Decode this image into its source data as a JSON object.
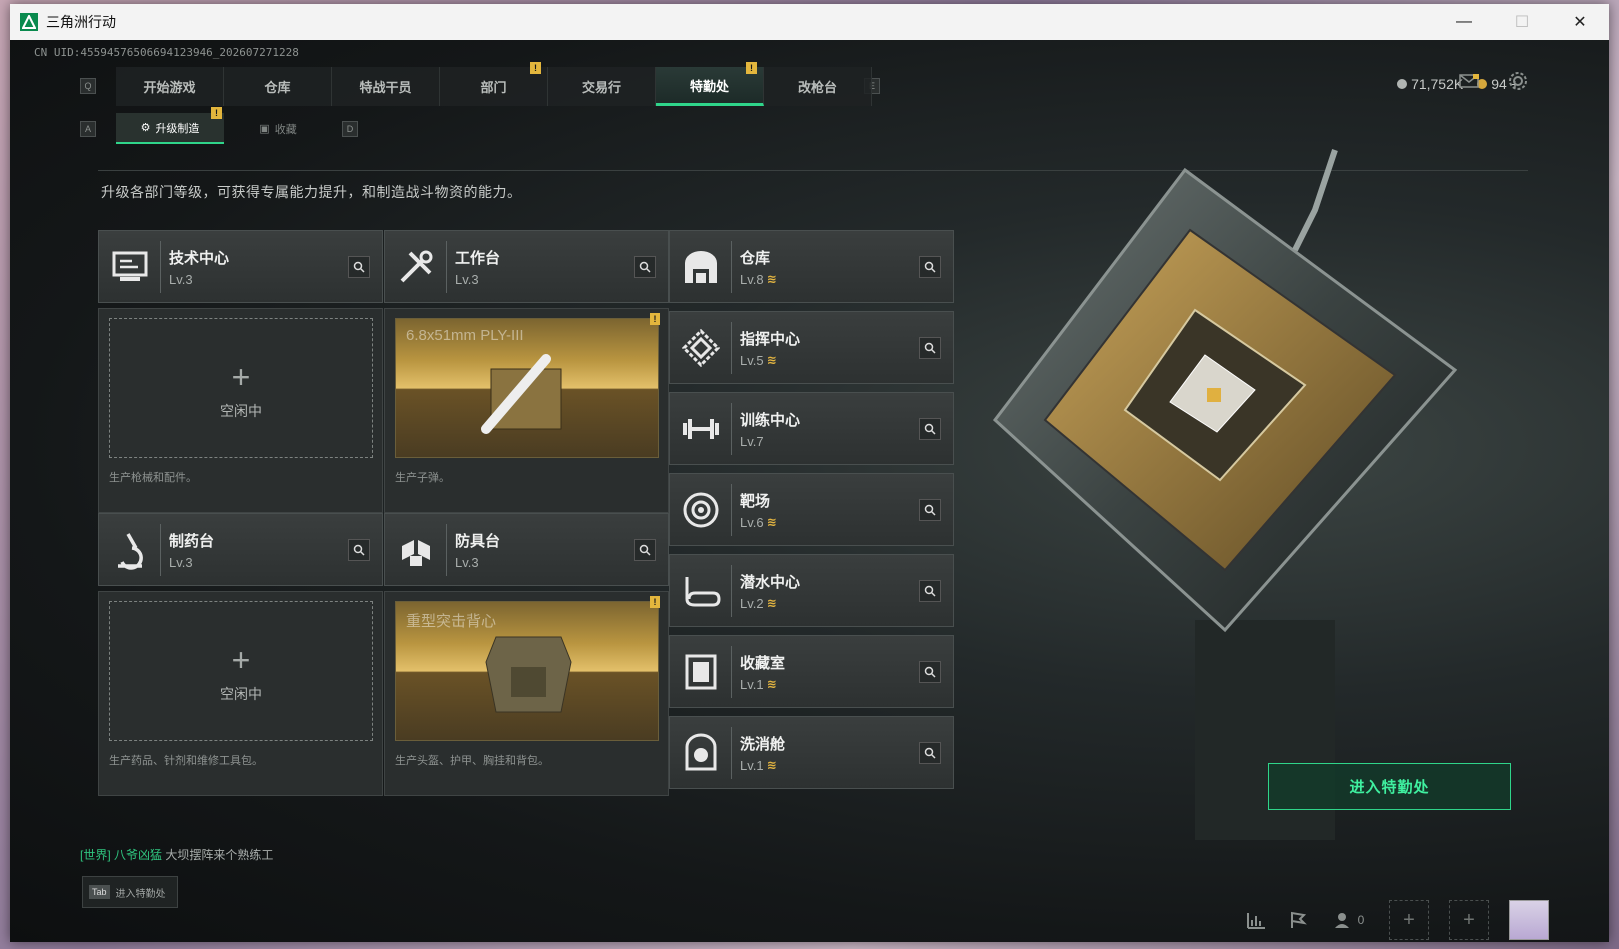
{
  "window": {
    "title": "三角洲行动",
    "minimize": "—",
    "maximize": "☐",
    "close": "✕"
  },
  "uid": "CN UID:4559457650669412394​6_202607271228",
  "tabs": [
    {
      "label": "开始游戏"
    },
    {
      "label": "仓库"
    },
    {
      "label": "特战干员"
    },
    {
      "label": "部门",
      "badge": "!"
    },
    {
      "label": "交易行"
    },
    {
      "label": "特勤处",
      "badge": "!",
      "active": true
    },
    {
      "label": "改枪台"
    }
  ],
  "keyhints": {
    "left": "Q",
    "right": "E",
    "sub_left": "A",
    "sub_right": "D"
  },
  "currency": {
    "silver": "71,752K",
    "gold": "94",
    "plus": "+"
  },
  "subtabs": [
    {
      "label": "升级制造",
      "badge": "!",
      "active": true
    },
    {
      "label": "收藏"
    }
  ],
  "description": "升级各部门等级，可获得专属能力提升，和制造战斗物资的能力。",
  "facilities_left": [
    {
      "name": "技术中心",
      "level": "Lv.3",
      "icon": "monitor-icon"
    },
    {
      "name": "工作台",
      "level": "Lv.3",
      "icon": "tools-icon"
    },
    {
      "name": "制药台",
      "level": "Lv.3",
      "icon": "microscope-icon"
    },
    {
      "name": "防具台",
      "level": "Lv.3",
      "icon": "armor-icon"
    }
  ],
  "slots": [
    {
      "state": "idle",
      "plus": "+",
      "idle_label": "空闲中",
      "caption": "生产枪械和配件。"
    },
    {
      "state": "producing",
      "item": "6.8x51mm PLY-III",
      "badge": "!",
      "caption": "生产子弹。"
    },
    {
      "state": "idle",
      "plus": "+",
      "idle_label": "空闲中",
      "caption": "生产药品、针剂和维修工具包。"
    },
    {
      "state": "producing",
      "item": "重型突击背心",
      "badge": "!",
      "caption": "生产头盔、护甲、胸挂和背包。"
    }
  ],
  "facilities_right": [
    {
      "name": "仓库",
      "level": "Lv.8",
      "upgrade": true,
      "icon": "warehouse-icon"
    },
    {
      "name": "指挥中心",
      "level": "Lv.5",
      "upgrade": true,
      "icon": "command-icon"
    },
    {
      "name": "训练中心",
      "level": "Lv.7",
      "upgrade": false,
      "icon": "dumbbell-icon"
    },
    {
      "name": "靶场",
      "level": "Lv.6",
      "upgrade": true,
      "icon": "target-icon"
    },
    {
      "name": "潜水中心",
      "level": "Lv.2",
      "upgrade": true,
      "icon": "diving-mask-icon"
    },
    {
      "name": "收藏室",
      "level": "Lv.1",
      "upgrade": true,
      "icon": "collection-icon"
    },
    {
      "name": "洗消舱",
      "level": "Lv.1",
      "upgrade": true,
      "icon": "decon-icon"
    }
  ],
  "upgrade_symbol": "≋",
  "enter_button": "进入特勤处",
  "chat": {
    "channel": "[世界]",
    "user": "八爷凶猛",
    "message": "大坝摆阵来个熟练工"
  },
  "tab_hint": {
    "key": "Tab",
    "label": "进入特勤处"
  },
  "friends_count": "0",
  "colors": {
    "accent": "#2fd58a",
    "badge": "#e3b63d",
    "upgrade": "#e2b441"
  }
}
